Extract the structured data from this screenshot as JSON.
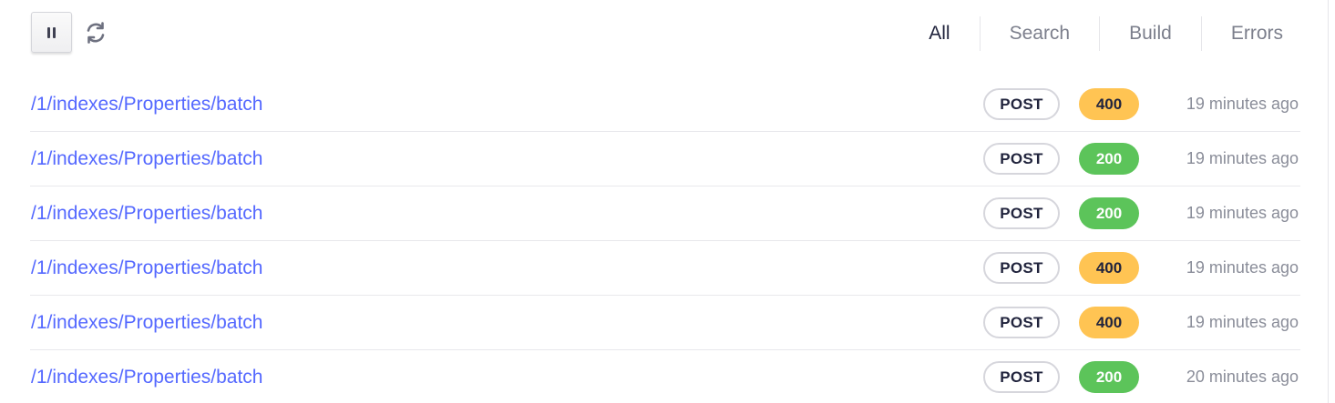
{
  "toolbar": {
    "pause_icon": "pause-icon",
    "refresh_icon": "refresh-icon"
  },
  "filters": {
    "tabs": [
      {
        "label": "All",
        "active": true
      },
      {
        "label": "Search",
        "active": false
      },
      {
        "label": "Build",
        "active": false
      },
      {
        "label": "Errors",
        "active": false
      }
    ]
  },
  "logs": [
    {
      "path": "/1/indexes/Properties/batch",
      "method": "POST",
      "status": "400",
      "time": "19 minutes ago"
    },
    {
      "path": "/1/indexes/Properties/batch",
      "method": "POST",
      "status": "200",
      "time": "19 minutes ago"
    },
    {
      "path": "/1/indexes/Properties/batch",
      "method": "POST",
      "status": "200",
      "time": "19 minutes ago"
    },
    {
      "path": "/1/indexes/Properties/batch",
      "method": "POST",
      "status": "400",
      "time": "19 minutes ago"
    },
    {
      "path": "/1/indexes/Properties/batch",
      "method": "POST",
      "status": "400",
      "time": "19 minutes ago"
    },
    {
      "path": "/1/indexes/Properties/batch",
      "method": "POST",
      "status": "200",
      "time": "20 minutes ago"
    }
  ],
  "colors": {
    "link": "#5468ff",
    "status_4xx": "#ffc453",
    "status_2xx": "#5cc45a"
  }
}
